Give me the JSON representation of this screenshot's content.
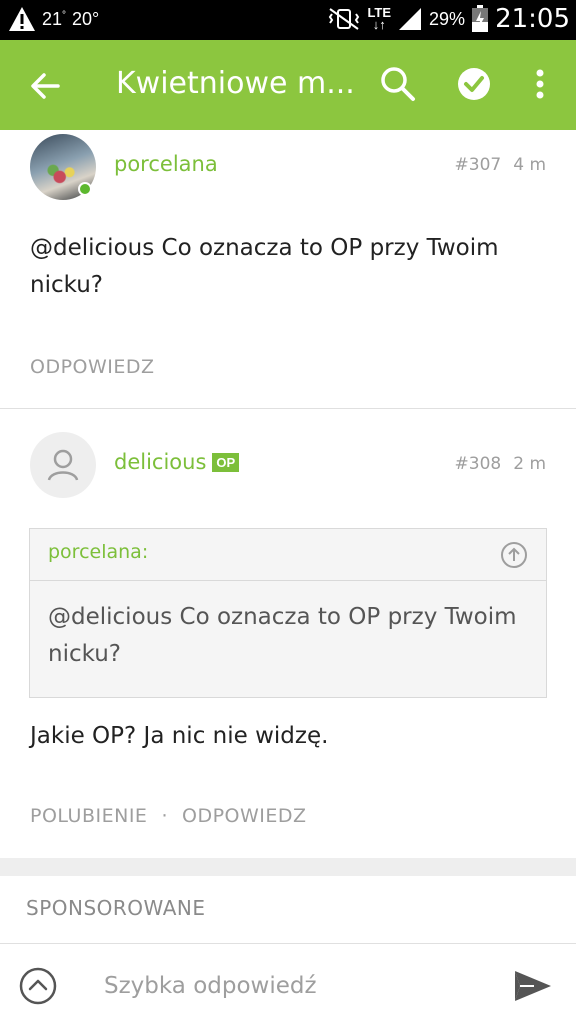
{
  "status_bar": {
    "temp_primary": "21",
    "temp_secondary": "20°",
    "network": "LTE",
    "battery": "29%",
    "time": "21:05"
  },
  "app_bar": {
    "title": "Kwietniowe m...",
    "icons": [
      "back-arrow-icon",
      "search-icon",
      "check-circle-icon",
      "more-vert-icon"
    ]
  },
  "comments": [
    {
      "author": "porcelana",
      "number": "#307",
      "time": "4 m",
      "text": "@delicious Co oznacza to OP przy Twoim nicku?",
      "actions": [
        "ODPOWIEDZ"
      ]
    },
    {
      "author": "delicious",
      "badge": "OP",
      "number": "#308",
      "time": "2 m",
      "quote": {
        "author": "porcelana:",
        "text": "@delicious Co oznacza to OP przy Twoim nicku?"
      },
      "text": "Jakie OP? Ja nic nie widzę.",
      "actions": [
        "POLUBIENIE",
        "ODPOWIEDZ"
      ],
      "separator": "·"
    }
  ],
  "sponsored_label": "SPONSOROWANE",
  "reply_bar": {
    "placeholder": "Szybka odpowiedź"
  },
  "colors": {
    "accent": "#8cc63f",
    "link_green": "#7cbf3a",
    "muted": "#9e9e9e"
  }
}
